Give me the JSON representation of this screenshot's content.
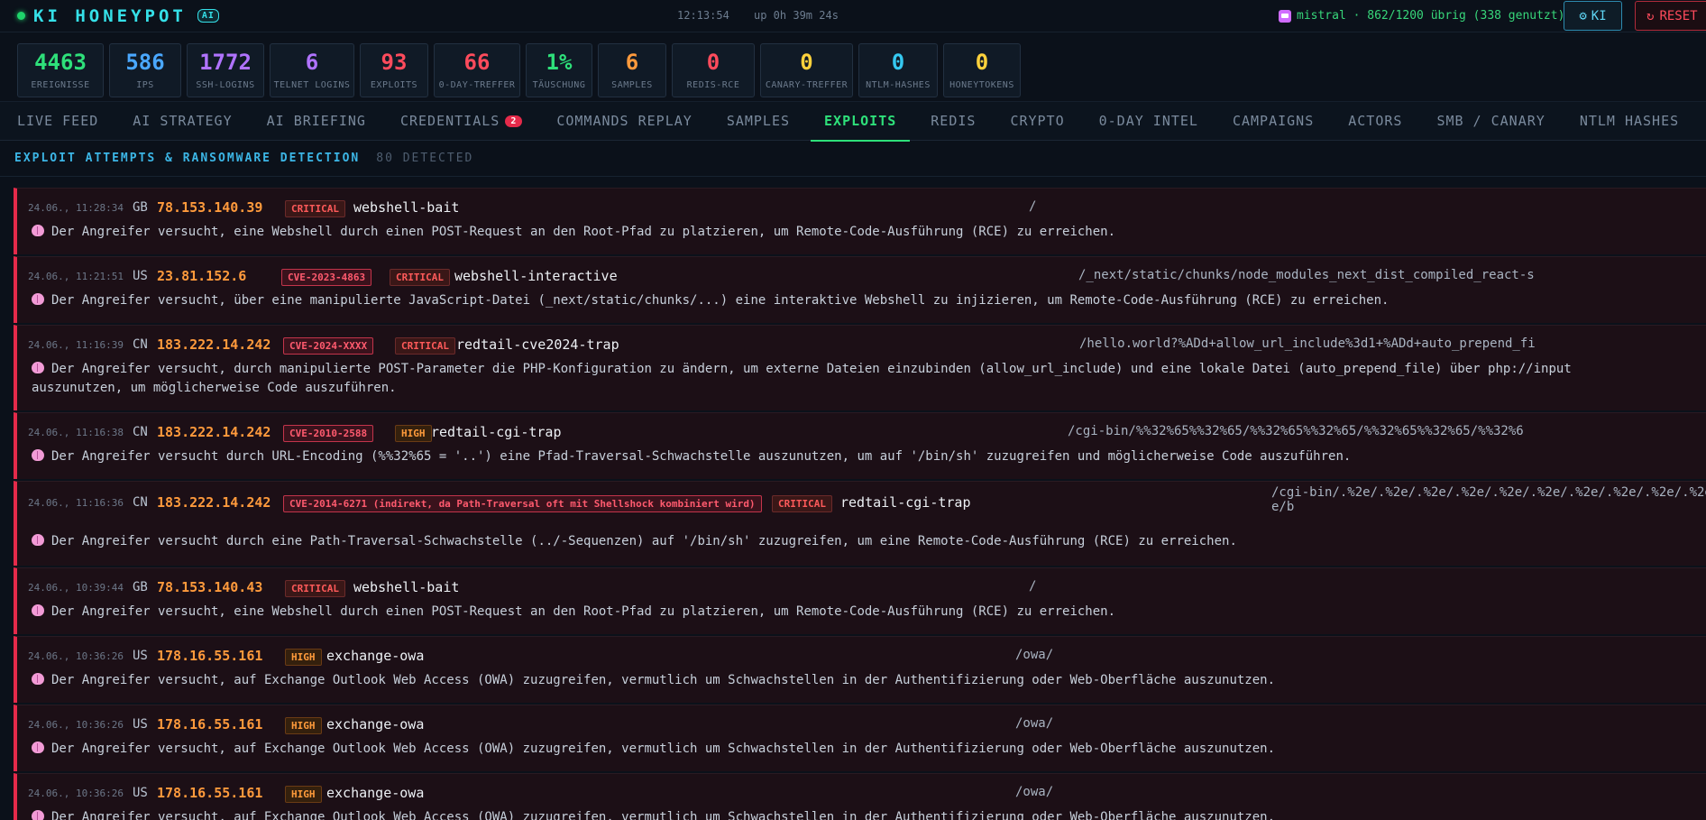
{
  "header": {
    "title": "KI HONEYPOT",
    "badge": "AI",
    "clock": "12:13:54",
    "uptime": "up 0h 39m 24s",
    "model_status": "mistral · 862/1200 übrig (338 genutzt)",
    "ki_button": "KI",
    "reset_button": "RESET"
  },
  "stats": [
    {
      "value": "4463",
      "label": "EREIGNISSE",
      "color": "#2ee07a"
    },
    {
      "value": "586",
      "label": "IPS",
      "color": "#4aa8ff"
    },
    {
      "value": "1772",
      "label": "SSH-LOGINS",
      "color": "#b073ff"
    },
    {
      "value": "6",
      "label": "TELNET LOGINS",
      "color": "#b073ff"
    },
    {
      "value": "93",
      "label": "EXPLOITS",
      "color": "#ff4b5c"
    },
    {
      "value": "66",
      "label": "0-DAY-TREFFER",
      "color": "#ff4b5c"
    },
    {
      "value": "1%",
      "label": "TÄUSCHUNG",
      "color": "#2ee07a"
    },
    {
      "value": "6",
      "label": "SAMPLES",
      "color": "#ff9a3c"
    },
    {
      "value": "0",
      "label": "REDIS-RCE",
      "color": "#ff4b5c"
    },
    {
      "value": "0",
      "label": "CANARY-TREFFER",
      "color": "#ffd23c"
    },
    {
      "value": "0",
      "label": "NTLM-HASHES",
      "color": "#35c8f0"
    },
    {
      "value": "0",
      "label": "HONEYTOKENS",
      "color": "#ffd23c"
    }
  ],
  "tabs": [
    {
      "label": "LIVE FEED"
    },
    {
      "label": "AI STRATEGY"
    },
    {
      "label": "AI BRIEFING"
    },
    {
      "label": "CREDENTIALS",
      "badge": "2"
    },
    {
      "label": "COMMANDS REPLAY"
    },
    {
      "label": "SAMPLES"
    },
    {
      "label": "EXPLOITS",
      "active": true
    },
    {
      "label": "REDIS"
    },
    {
      "label": "CRYPTO"
    },
    {
      "label": "0-DAY INTEL"
    },
    {
      "label": "CAMPAIGNS"
    },
    {
      "label": "ACTORS"
    },
    {
      "label": "SMB / CANARY"
    },
    {
      "label": "NTLM HASHES"
    }
  ],
  "section": {
    "title": "EXPLOIT ATTEMPTS & RANSOMWARE DETECTION",
    "count": "80 DETECTED"
  },
  "entries": [
    {
      "time": "24.06., 11:28:34",
      "country": "GB",
      "ip": "78.153.140.39",
      "cve": "",
      "severity": "CRITICAL",
      "name": "webshell-bait",
      "path": "/",
      "desc": "Der Angreifer versucht, eine Webshell durch einen POST-Request an den Root-Pfad zu platzieren, um Remote-Code-Ausführung (RCE) zu erreichen."
    },
    {
      "time": "24.06., 11:21:51",
      "country": "US",
      "ip": "23.81.152.6",
      "cve": "CVE-2023-4863",
      "severity": "CRITICAL",
      "name": "webshell-interactive",
      "path": "/_next/static/chunks/node_modules_next_dist_compiled_react-s",
      "desc": "Der Angreifer versucht, über eine manipulierte JavaScript-Datei (_next/static/chunks/...) eine interaktive Webshell zu injizieren, um Remote-Code-Ausführung (RCE) zu erreichen."
    },
    {
      "time": "24.06., 11:16:39",
      "country": "CN",
      "ip": "183.222.14.242",
      "cve": "CVE-2024-XXXX",
      "severity": "CRITICAL",
      "name": "redtail-cve2024-trap",
      "path": "/hello.world?%ADd+allow_url_include%3d1+%ADd+auto_prepend_fi",
      "desc": "Der Angreifer versucht, durch manipulierte POST-Parameter die PHP-Konfiguration zu ändern, um externe Dateien einzubinden (allow_url_include) und eine lokale Datei (auto_prepend_file) über php://input auszunutzen, um möglicherweise Code auszuführen."
    },
    {
      "time": "24.06., 11:16:38",
      "country": "CN",
      "ip": "183.222.14.242",
      "cve": "CVE-2010-2588",
      "severity": "HIGH",
      "name": "redtail-cgi-trap",
      "path": "/cgi-bin/%%32%65%%32%65/%%32%65%%32%65/%%32%65%%32%65/%%32%6",
      "desc": "Der Angreifer versucht durch URL-Encoding (%%32%65 = '..') eine Pfad-Traversal-Schwachstelle auszunutzen, um auf '/bin/sh' zuzugreifen und möglicherweise Code auszuführen."
    },
    {
      "time": "24.06., 11:16:36",
      "country": "CN",
      "ip": "183.222.14.242",
      "cve": "CVE-2014-6271 (indirekt, da Path-Traversal oft mit Shellshock kombiniert wird)",
      "severity": "CRITICAL",
      "name": "redtail-cgi-trap",
      "path": "/cgi-bin/.%2e/.%2e/.%2e/.%2e/.%2e/.%2e/.%2e/.%2e/.%2e/.%2e\ne/b",
      "desc": "Der Angreifer versucht durch eine Path-Traversal-Schwachstelle (../-Sequenzen) auf '/bin/sh' zuzugreifen, um eine Remote-Code-Ausführung (RCE) zu erreichen."
    },
    {
      "time": "24.06., 10:39:44",
      "country": "GB",
      "ip": "78.153.140.43",
      "cve": "",
      "severity": "CRITICAL",
      "name": "webshell-bait",
      "path": "/",
      "desc": "Der Angreifer versucht, eine Webshell durch einen POST-Request an den Root-Pfad zu platzieren, um Remote-Code-Ausführung (RCE) zu erreichen."
    },
    {
      "time": "24.06., 10:36:26",
      "country": "US",
      "ip": "178.16.55.161",
      "cve": "",
      "severity": "HIGH",
      "name": "exchange-owa",
      "path": "/owa/",
      "desc": "Der Angreifer versucht, auf Exchange Outlook Web Access (OWA) zuzugreifen, vermutlich um Schwachstellen in der Authentifizierung oder Web-Oberfläche auszunutzen."
    },
    {
      "time": "24.06., 10:36:26",
      "country": "US",
      "ip": "178.16.55.161",
      "cve": "",
      "severity": "HIGH",
      "name": "exchange-owa",
      "path": "/owa/",
      "desc": "Der Angreifer versucht, auf Exchange Outlook Web Access (OWA) zuzugreifen, vermutlich um Schwachstellen in der Authentifizierung oder Web-Oberfläche auszunutzen."
    },
    {
      "time": "24.06., 10:36:26",
      "country": "US",
      "ip": "178.16.55.161",
      "cve": "",
      "severity": "HIGH",
      "name": "exchange-owa",
      "path": "/owa/",
      "desc": "Der Angreifer versucht, auf Exchange Outlook Web Access (OWA) zuzugreifen, vermutlich um Schwachstellen in der Authentifizierung oder Web-Oberfläche auszunutzen."
    }
  ]
}
